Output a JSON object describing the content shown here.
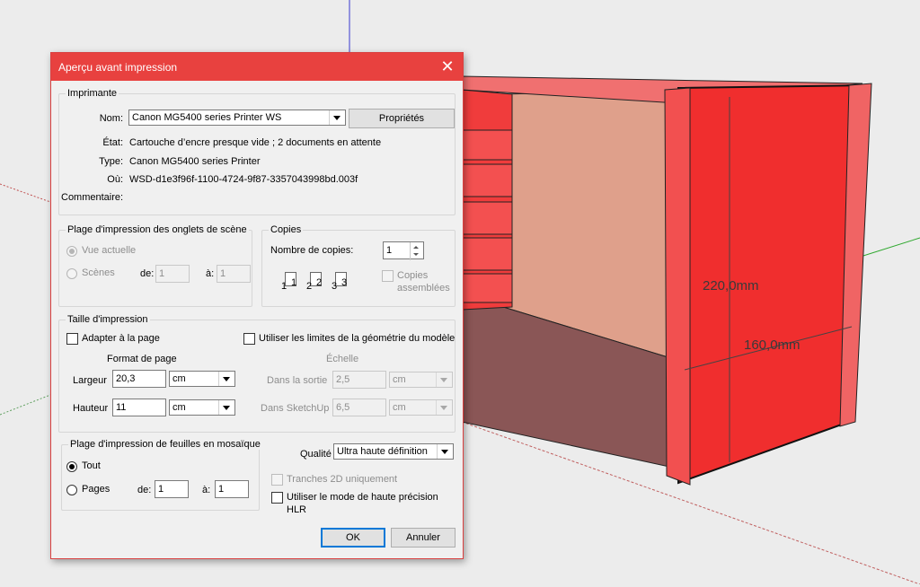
{
  "viewport": {
    "dim_height": "220,0mm",
    "dim_depth": "160,0mm",
    "colors": {
      "face": "#f02e2e",
      "inner": "#e0a08c",
      "floor": "#8c5656",
      "background": "#ececec"
    }
  },
  "dialog": {
    "title": "Aperçu avant impression",
    "close_icon": "close-icon",
    "accent": "#e8413f",
    "printer": {
      "legend": "Imprimante",
      "name_label": "Nom:",
      "name_value": "Canon MG5400 series Printer WS",
      "properties_button": "Propriétés",
      "state_label": "État:",
      "state_value": "Cartouche d’encre presque vide ; 2 documents en attente",
      "type_label": "Type:",
      "type_value": "Canon MG5400 series Printer",
      "where_label": "Où:",
      "where_value": "WSD-d1e3f96f-1100-4724-9f87-3357043998bd.003f",
      "comment_label": "Commentaire:"
    },
    "scene_range": {
      "legend": "Plage d'impression des onglets de scène",
      "current_view": "Vue actuelle",
      "scenes": "Scènes",
      "from_label": "de:",
      "from_value": "1",
      "to_label": "à:",
      "to_value": "1"
    },
    "copies": {
      "legend": "Copies",
      "count_label": "Nombre de copies:",
      "count_value": "1",
      "collate_line1": "Copies",
      "collate_line2": "assemblées",
      "collate_icon": "collate-pages-icon",
      "page_numbers": [
        "1",
        "1",
        "2",
        "2",
        "3",
        "3"
      ]
    },
    "print_size": {
      "legend": "Taille d'impression",
      "fit_page": "Adapter à la page",
      "use_model_extents": "Utiliser les limites de la géométrie du modèle",
      "page_format": "Format de page",
      "width_label": "Largeur",
      "width_value": "20,3",
      "width_unit": "cm",
      "height_label": "Hauteur",
      "height_value": "11",
      "height_unit": "cm",
      "scale": "Échelle",
      "in_output_label": "Dans la sortie",
      "in_output_value": "2,5",
      "in_output_unit": "cm",
      "in_sketchup_label": "Dans SketchUp",
      "in_sketchup_value": "6,5",
      "in_sketchup_unit": "cm"
    },
    "tiled_range": {
      "legend": "Plage d'impression de feuilles en mosaïque",
      "all": "Tout",
      "pages": "Pages",
      "from_label": "de:",
      "from_value": "1",
      "to_label": "à:",
      "to_value": "1"
    },
    "quality": {
      "label": "Qualité",
      "value": "Ultra haute définition",
      "only_2d": "Tranches 2D uniquement",
      "hlr_line1": "Utiliser le mode de haute précision",
      "hlr_line2": "HLR"
    },
    "ok_button": "OK",
    "cancel_button": "Annuler"
  }
}
